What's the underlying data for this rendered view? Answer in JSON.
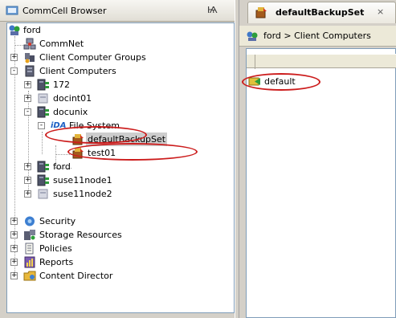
{
  "left_panel": {
    "title": "CommCell Browser",
    "pin": "Ѩ"
  },
  "tree": [
    {
      "label": "ford",
      "icon": "commcell-icon"
    },
    {
      "label": "CommNet",
      "icon": "network-icon"
    },
    {
      "label": "Client Computer Groups",
      "icon": "group-icon",
      "toggle": "+"
    },
    {
      "label": "Client Computers",
      "icon": "server-icon",
      "toggle": "-"
    },
    {
      "label": "172",
      "icon": "client-icon",
      "toggle": "+"
    },
    {
      "label": "docint01",
      "icon": "disabled-client-icon",
      "toggle": "+"
    },
    {
      "label": "docunix",
      "icon": "client-icon",
      "toggle": "-"
    },
    {
      "label": "File System",
      "prefix": "iDA",
      "icon": "file-system-icon",
      "toggle": "-"
    },
    {
      "label": "defaultBackupSet",
      "icon": "backupset-icon"
    },
    {
      "label": "test01",
      "icon": "backupset-icon"
    },
    {
      "label": "ford",
      "icon": "client-icon",
      "toggle": "+"
    },
    {
      "label": "suse11node1",
      "icon": "client-icon",
      "toggle": "+"
    },
    {
      "label": "suse11node2",
      "icon": "disabled-client-icon",
      "toggle": "+"
    },
    {
      "label": "Security",
      "icon": "security-icon",
      "toggle": "+"
    },
    {
      "label": "Storage Resources",
      "icon": "storage-icon",
      "toggle": "+"
    },
    {
      "label": "Policies",
      "icon": "policies-icon",
      "toggle": "+"
    },
    {
      "label": "Reports",
      "icon": "reports-icon",
      "toggle": "+"
    },
    {
      "label": "Content Director",
      "icon": "content-director-icon",
      "toggle": "+"
    }
  ],
  "right_panel": {
    "tab_title": "defaultBackupSet",
    "tab_close": "×",
    "breadcrumb": "ford  >   Client Computers",
    "list_items": [
      {
        "label": "default",
        "icon": "subclient-icon"
      }
    ]
  },
  "colors": {
    "highlight": "#cc1c1c",
    "panel_bg": "#d4d0c8"
  }
}
